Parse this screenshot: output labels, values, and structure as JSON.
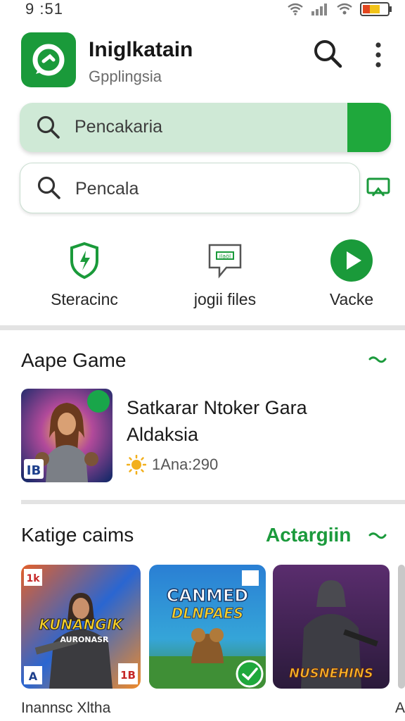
{
  "status_bar": {
    "time": "9 :51"
  },
  "header": {
    "title": "Iniglkatain",
    "subtitle": "Gpplingsia",
    "search_icon": "search-icon",
    "more_icon": "more-vert-icon"
  },
  "search_primary": {
    "placeholder": "Pencakaria"
  },
  "search_secondary": {
    "placeholder": "Pencala"
  },
  "quick_actions": [
    {
      "label": "Steracinc",
      "icon": "shield-icon"
    },
    {
      "label": "jogii files",
      "icon": "chat-file-icon"
    },
    {
      "label": "Vacke",
      "icon": "play-icon"
    }
  ],
  "section_featured": {
    "title": "Aape Game",
    "game": {
      "title_line1": "Satkarar Ntoker Gara",
      "title_line2": "Aldaksia",
      "rating_text": "1Ana:290",
      "badge": "IB"
    }
  },
  "section_categories": {
    "title": "Katige caims",
    "action": "Actargiin",
    "cards": [
      {
        "art_title": "KUNANGIK",
        "art_sub": "AURONASR",
        "badge_tl": "1k",
        "badge_bl": "A",
        "badge_br": "1B",
        "caption": "Inannsc Xltha"
      },
      {
        "art_title": "CANMED",
        "art_sub": "DLNPAES",
        "caption": ""
      },
      {
        "art_title": "NUSNEHINS",
        "caption": ""
      }
    ],
    "partial_caption": "A"
  },
  "colors": {
    "brand_green": "#1a9a3a",
    "accent_green": "#1fa83c",
    "search_tint": "#cfe9d6"
  }
}
